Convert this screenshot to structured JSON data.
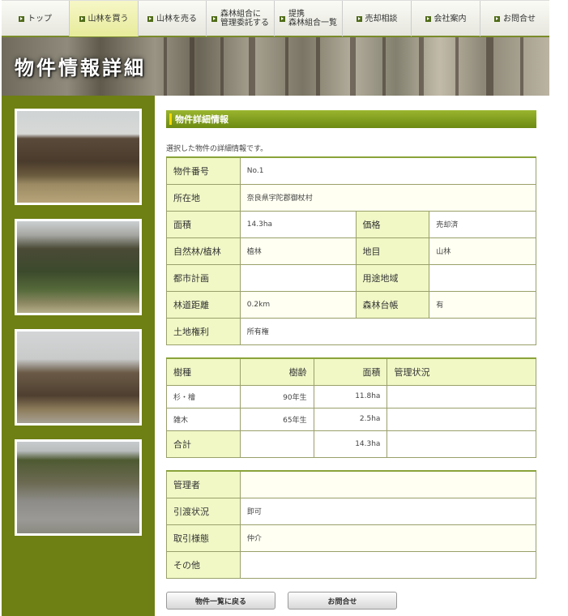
{
  "nav": {
    "items": [
      {
        "label": "トップ",
        "label2": "",
        "active": false
      },
      {
        "label": "山林を買う",
        "label2": "",
        "active": true
      },
      {
        "label": "山林を売る",
        "label2": "",
        "active": false
      },
      {
        "label": "森林組合に",
        "label2": "管理委託する",
        "active": false
      },
      {
        "label": "提携",
        "label2": "森林組合一覧",
        "active": false
      },
      {
        "label": "売却相談",
        "label2": "",
        "active": false
      },
      {
        "label": "会社案内",
        "label2": "",
        "active": false
      },
      {
        "label": "お問合せ",
        "label2": "",
        "active": false
      }
    ]
  },
  "banner": {
    "title": "物件情報詳細"
  },
  "section": {
    "title": "物件詳細情報",
    "intro": "選択した物件の詳細情報です。"
  },
  "property": {
    "number_label": "物件番号",
    "number": "No.1",
    "location_label": "所在地",
    "location": "奈良県宇陀郡御杖村",
    "area_label": "面積",
    "area": "14.3ha",
    "price_label": "価格",
    "price": "売却済",
    "forest_type_label": "自然林/植林",
    "forest_type": "植林",
    "land_category_label": "地目",
    "land_category": "山林",
    "city_planning_label": "都市計画",
    "city_planning": "",
    "zoning_label": "用途地域",
    "zoning": "",
    "road_distance_label": "林道距離",
    "road_distance": "0.2km",
    "forest_ledger_label": "森林台帳",
    "forest_ledger": "有",
    "land_rights_label": "土地権利",
    "land_rights": "所有権"
  },
  "trees": {
    "headers": {
      "species": "樹種",
      "age": "樹齢",
      "area": "面積",
      "status": "管理状況"
    },
    "rows": [
      {
        "species": "杉・檜",
        "age": "90年生",
        "area": "11.8ha",
        "status": ""
      },
      {
        "species": "雑木",
        "age": "65年生",
        "area": "2.5ha",
        "status": ""
      }
    ],
    "total_label": "合計",
    "total_area": "14.3ha"
  },
  "management": {
    "manager_label": "管理者",
    "manager": "",
    "transfer_label": "引渡状況",
    "transfer": "即可",
    "deal_label": "取引様態",
    "deal": "仲介",
    "other_label": "その他",
    "other": ""
  },
  "buttons": {
    "back": "物件一覧に戻る",
    "contact": "お問合せ"
  },
  "sidebar": {
    "photos": [
      "photo-1",
      "photo-2",
      "photo-3",
      "photo-4"
    ]
  },
  "colors": {
    "accent": "#6e7f13",
    "header": "#7f9b20",
    "label_bg": "#f1f8c6"
  }
}
